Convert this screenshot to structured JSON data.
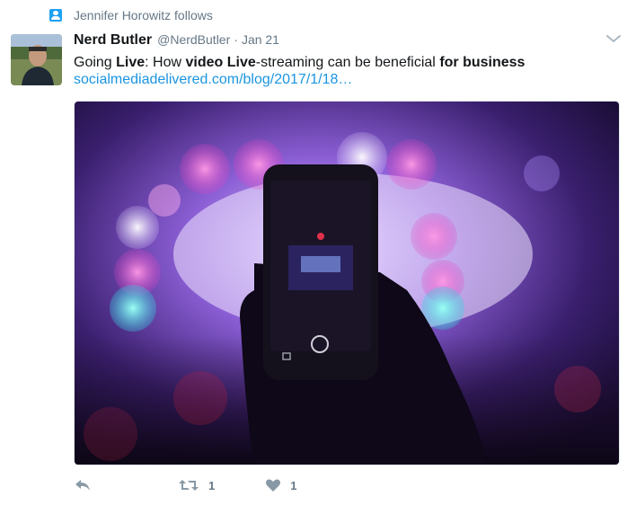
{
  "context": {
    "text": "Jennifer Horowitz follows"
  },
  "tweet": {
    "fullname": "Nerd Butler",
    "username": "@NerdButler",
    "separator": "·",
    "date": "Jan 21",
    "text_parts": [
      {
        "text": "Going ",
        "bold": false
      },
      {
        "text": "Live",
        "bold": true
      },
      {
        "text": ": How ",
        "bold": false
      },
      {
        "text": "video Live",
        "bold": true
      },
      {
        "text": "-streaming can be beneficial ",
        "bold": false
      },
      {
        "text": "for business",
        "bold": true
      }
    ],
    "link": "socialmediadelivered.com/blog/2017/1/18…"
  },
  "actions": {
    "reply": {
      "icon": "reply-icon"
    },
    "retweet": {
      "icon": "retweet-icon",
      "count": "1"
    },
    "like": {
      "icon": "heart-icon",
      "count": "1"
    }
  },
  "colors": {
    "accent": "#1da1f2",
    "link": "#1b95e0",
    "muted": "#657786",
    "text": "#14171a"
  }
}
